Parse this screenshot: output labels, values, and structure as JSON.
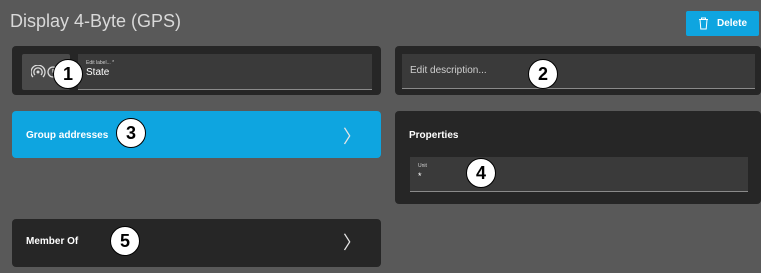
{
  "header": {
    "title": "Display 4-Byte (GPS)",
    "delete_label": "Delete"
  },
  "label_card": {
    "icon": "broadcast-clock-icon",
    "field_label": "Edit label... *",
    "field_value": "State"
  },
  "description_card": {
    "placeholder": "Edit description..."
  },
  "group_addresses": {
    "label": "Group addresses"
  },
  "properties": {
    "title": "Properties",
    "unit_label": "Unit",
    "unit_value": "*"
  },
  "member_of": {
    "label": "Member Of"
  },
  "callouts": [
    "1",
    "2",
    "3",
    "4",
    "5"
  ],
  "colors": {
    "accent": "#0ea5e0",
    "card": "#262626",
    "background": "#595959"
  }
}
